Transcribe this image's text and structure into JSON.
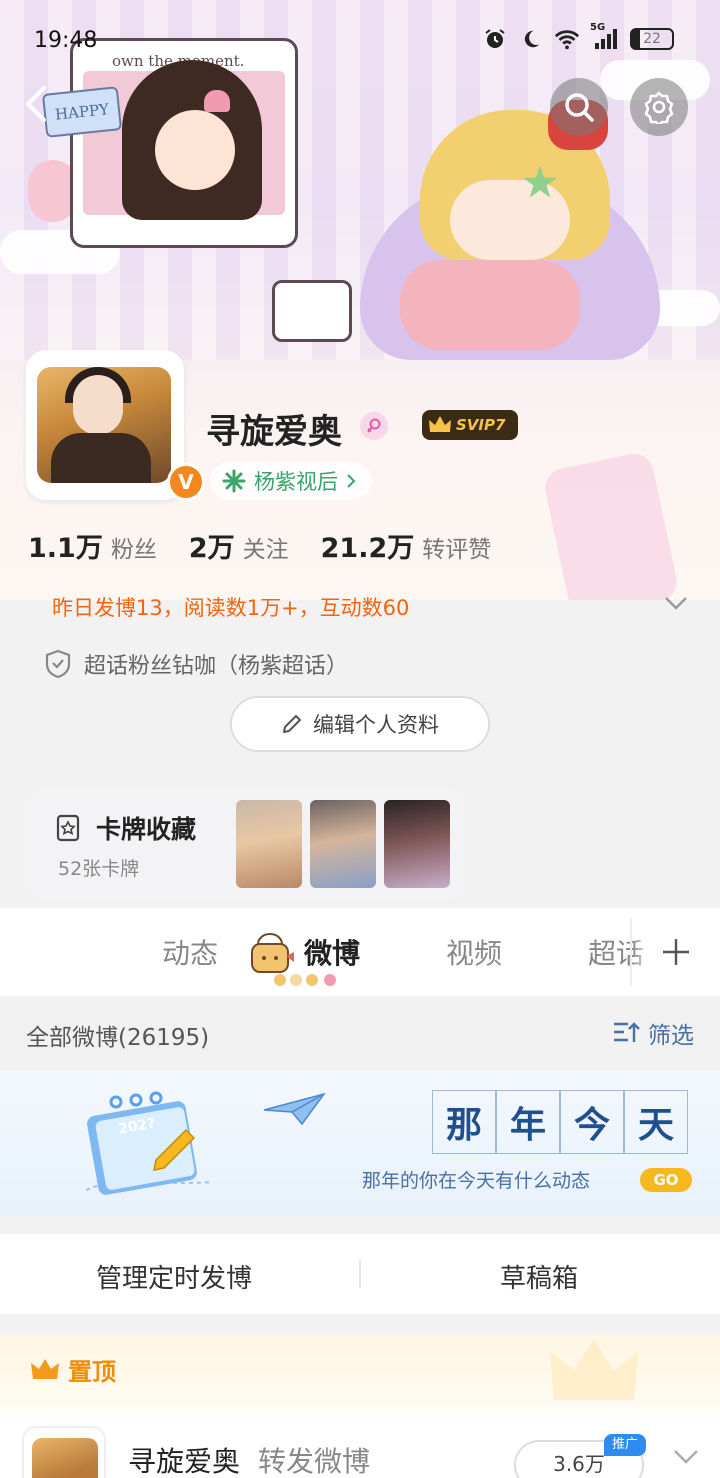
{
  "status_bar": {
    "time": "19:48",
    "battery": "22",
    "network": "5G"
  },
  "banner": {
    "frame_caption": "own the moment.",
    "tag_text": "HAPPY"
  },
  "profile": {
    "name": "寻旋爱奥",
    "vip_label": "SVIP7",
    "verified_mark": "V",
    "super_topic": "杨紫视后",
    "stats": [
      {
        "num": "1.1万",
        "label": "粉丝"
      },
      {
        "num": "2万",
        "label": "关注"
      },
      {
        "num": "21.2万",
        "label": "转评赞"
      }
    ],
    "yesterday_summary": "昨日发博13，阅读数1万+，互动数60",
    "fan_club": "超话粉丝钻咖（杨紫超话）",
    "edit_label": "编辑个人资料"
  },
  "cards": {
    "title": "卡牌收藏",
    "count": "52张卡牌"
  },
  "tabs": {
    "items": [
      "动态",
      "微博",
      "视频",
      "超话"
    ],
    "active": "微博"
  },
  "all_weibo": {
    "title": "全部微博(26195)",
    "filter_label": "筛选"
  },
  "that_year": {
    "chars": [
      "那",
      "年",
      "今",
      "天"
    ],
    "subtitle": "那年的你在今天有什么动态",
    "go_label": "GO",
    "calendar_year": "202?"
  },
  "manage": {
    "scheduled": "管理定时发博",
    "drafts": "草稿箱"
  },
  "pinned": {
    "label": "置顶",
    "post": {
      "name": "寻旋爱奥",
      "action": "转发微博",
      "reads": "3.6万",
      "ad_tag": "推广"
    }
  },
  "colors": {
    "accent_orange": "#f2640d",
    "link_blue": "#4a6fa5",
    "super_green": "#3aa46a",
    "vip_gold": "#f5c34a"
  }
}
